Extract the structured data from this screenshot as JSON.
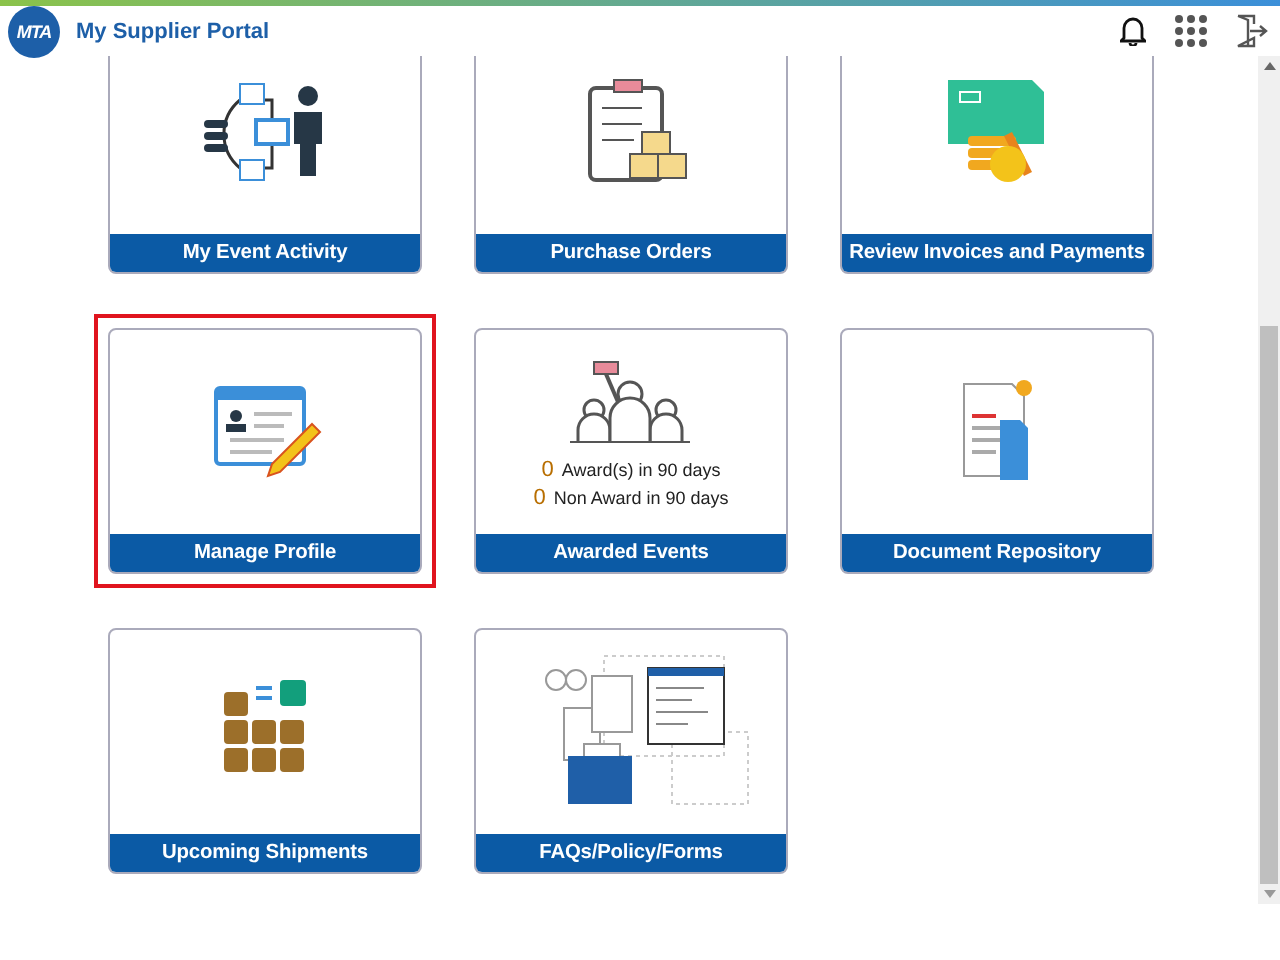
{
  "header": {
    "logo": "MTA",
    "title": "My Supplier Portal"
  },
  "tiles": [
    {
      "label": "My Event Activity",
      "selected": false
    },
    {
      "label": "Purchase Orders",
      "selected": false
    },
    {
      "label": "Review Invoices and Payments",
      "selected": false
    },
    {
      "label": "Manage Profile",
      "selected": true
    },
    {
      "label": "Awarded Events",
      "selected": false,
      "stats": [
        {
          "count": "0",
          "text": "Award(s) in 90 days"
        },
        {
          "count": "0",
          "text": "Non Award in 90 days"
        }
      ]
    },
    {
      "label": "Document Repository",
      "selected": false
    },
    {
      "label": "Upcoming Shipments",
      "selected": false
    },
    {
      "label": "FAQs/Policy/Forms",
      "selected": false
    }
  ]
}
